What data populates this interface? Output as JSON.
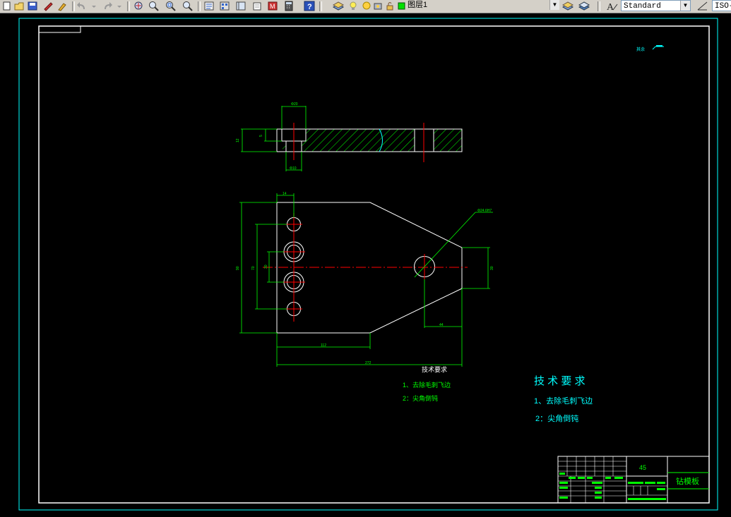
{
  "toolbar": {
    "layer_combo": {
      "value": "图层1"
    },
    "textstyle_combo": {
      "value": "Standard"
    },
    "dimstyle_combo": {
      "value": "ISO-"
    }
  },
  "drawing": {
    "roughness_note": "其余",
    "dims": {
      "top_hole_width": "Φ20",
      "top_hole_bottom": "Φ10",
      "thickness": "12",
      "counterbore_depth": "5",
      "width_left": "14",
      "overall_height": "90",
      "hole_span_outer": "70",
      "hole_span_inner": "30",
      "tail_height": "30",
      "tail_length": "44",
      "len_112": "112",
      "overall_length": "272",
      "big_hole": "Φ24.6H7"
    },
    "tech_req_small": {
      "title": "技术要求",
      "line1": "1、去除毛刺飞边",
      "line2": "2：尖角倒钝"
    },
    "tech_req_large": {
      "title": "技 术 要 求",
      "line1": "1、去除毛刺飞边",
      "line2": "2：尖角倒钝"
    },
    "title_block": {
      "material": "45",
      "part_name": "钻模板"
    }
  },
  "colors": {
    "outline": "#ffffff",
    "dimension": "#00ff00",
    "centerline": "#ff0000",
    "text_cyan": "#00ffff",
    "sheet_border": "#00ffff"
  }
}
